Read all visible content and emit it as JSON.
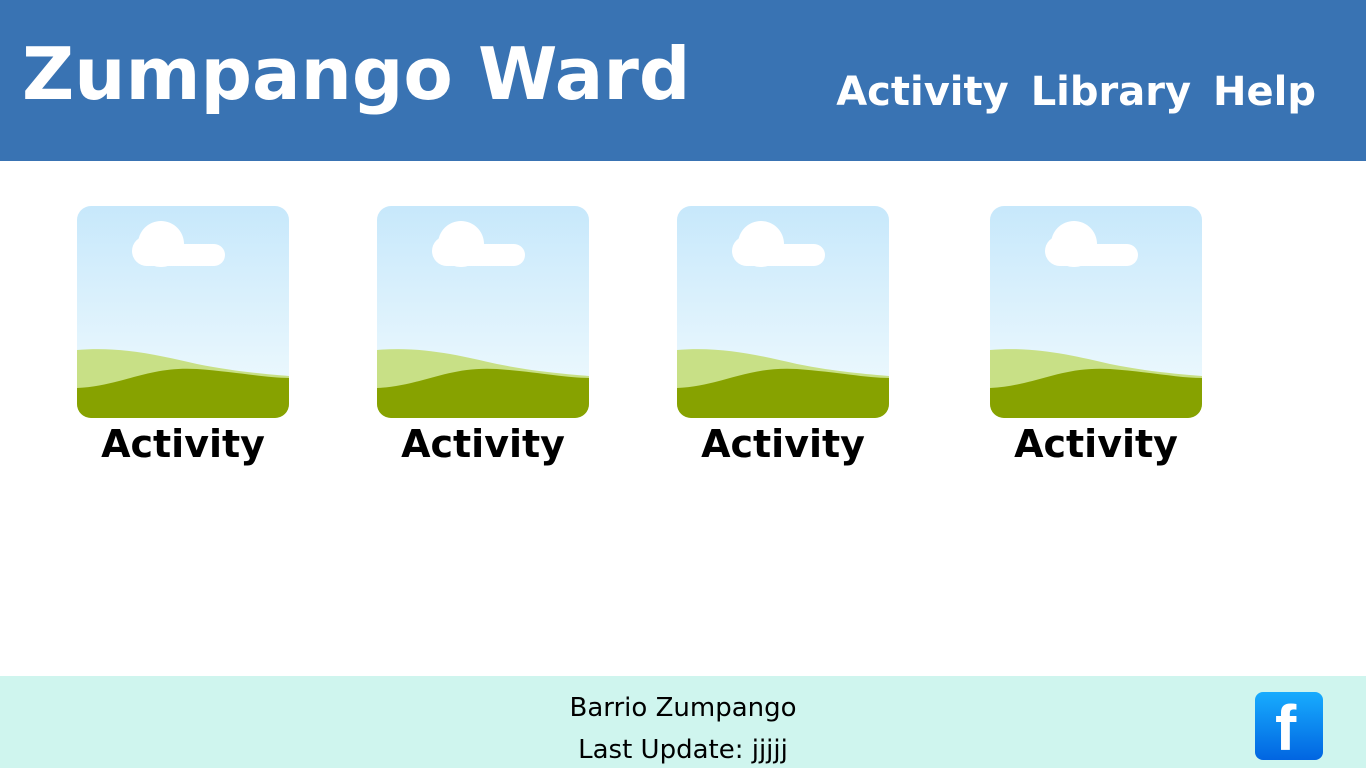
{
  "header": {
    "title": "Zumpango Ward",
    "nav": [
      "Activity",
      "Library",
      "Help"
    ]
  },
  "cards": [
    {
      "label": "Activity",
      "icon": "landscape-placeholder-icon"
    },
    {
      "label": "Activity",
      "icon": "landscape-placeholder-icon"
    },
    {
      "label": "Activity",
      "icon": "landscape-placeholder-icon"
    },
    {
      "label": "Activity",
      "icon": "landscape-placeholder-icon"
    }
  ],
  "footer": {
    "name": "Barrio Zumpango",
    "last_update": "Last Update: jjjjj",
    "social_icon": "facebook-icon",
    "social_letter": "f"
  },
  "colors": {
    "header_bg": "#3973b3",
    "footer_bg": "#cff5ee",
    "facebook_blue": "#0165e1"
  }
}
